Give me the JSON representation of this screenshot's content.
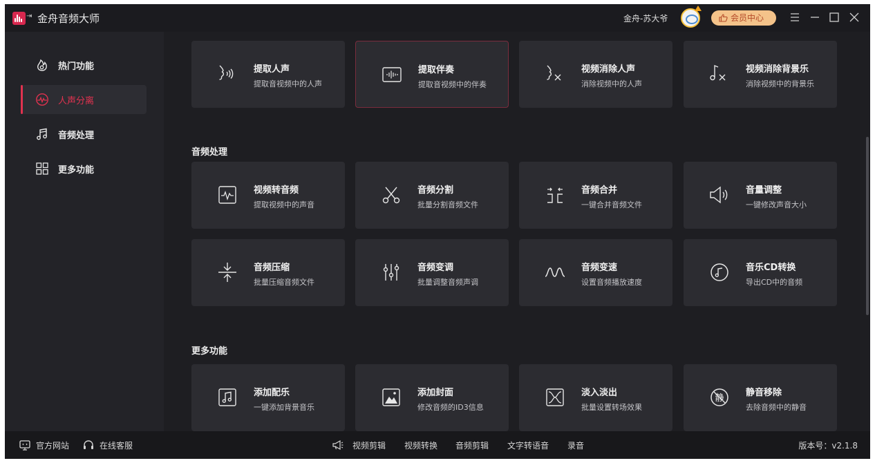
{
  "app": {
    "title": "金舟音频大师",
    "username": "金舟-苏大爷",
    "vip_label": "会员中心"
  },
  "sidebar": {
    "items": [
      {
        "label": "热门功能",
        "icon": "fire-icon",
        "active": false
      },
      {
        "label": "人声分离",
        "icon": "waveform-circle-icon",
        "active": true
      },
      {
        "label": "音频处理",
        "icon": "music-note-icon",
        "active": false
      },
      {
        "label": "更多功能",
        "icon": "grid-icon",
        "active": false
      }
    ]
  },
  "sections": {
    "vocal": {
      "cards": [
        {
          "title": "提取人声",
          "desc": "提取音视频中的人声",
          "icon": "voice-extract-icon"
        },
        {
          "title": "提取伴奏",
          "desc": "提取音视频中的伴奏",
          "icon": "accompaniment-icon"
        },
        {
          "title": "视频消除人声",
          "desc": "消除视频中的人声",
          "icon": "voice-remove-icon"
        },
        {
          "title": "视频消除背景乐",
          "desc": "消除视频中的背景乐",
          "icon": "music-remove-icon"
        }
      ]
    },
    "audio": {
      "title": "音频处理",
      "cards": [
        {
          "title": "视频转音频",
          "desc": "提取视频中的声音",
          "icon": "video-to-audio-icon"
        },
        {
          "title": "音频分割",
          "desc": "批量分割音频文件",
          "icon": "scissors-icon"
        },
        {
          "title": "音频合并",
          "desc": "一键合并音频文件",
          "icon": "merge-icon"
        },
        {
          "title": "音量调整",
          "desc": "一键修改声音大小",
          "icon": "volume-icon"
        },
        {
          "title": "音频压缩",
          "desc": "批量压缩音频文件",
          "icon": "compress-icon"
        },
        {
          "title": "音频变调",
          "desc": "批量调整音频声调",
          "icon": "equalizer-icon"
        },
        {
          "title": "音频变速",
          "desc": "设置音频播放速度",
          "icon": "speed-wave-icon"
        },
        {
          "title": "音乐CD转换",
          "desc": "导出CD中的音频",
          "icon": "cd-icon"
        }
      ]
    },
    "more": {
      "title": "更多功能",
      "cards": [
        {
          "title": "添加配乐",
          "desc": "一键添加背景音乐",
          "icon": "add-music-icon"
        },
        {
          "title": "添加封面",
          "desc": "修改音频的ID3信息",
          "icon": "image-icon"
        },
        {
          "title": "淡入淡出",
          "desc": "批量设置转场效果",
          "icon": "fade-icon"
        },
        {
          "title": "静音移除",
          "desc": "去除音频中的静音",
          "icon": "mute-remove-icon"
        }
      ]
    }
  },
  "footer": {
    "website": "官方网站",
    "service": "在线客服",
    "promo_links": [
      "视频剪辑",
      "视频转换",
      "音频剪辑",
      "文字转语音",
      "录音"
    ],
    "version": "版本号：v2.1.8"
  },
  "colors": {
    "accent": "#e0324f",
    "background": "#1e1e22",
    "card": "#2c2c31",
    "vip": "#f4c38a"
  }
}
